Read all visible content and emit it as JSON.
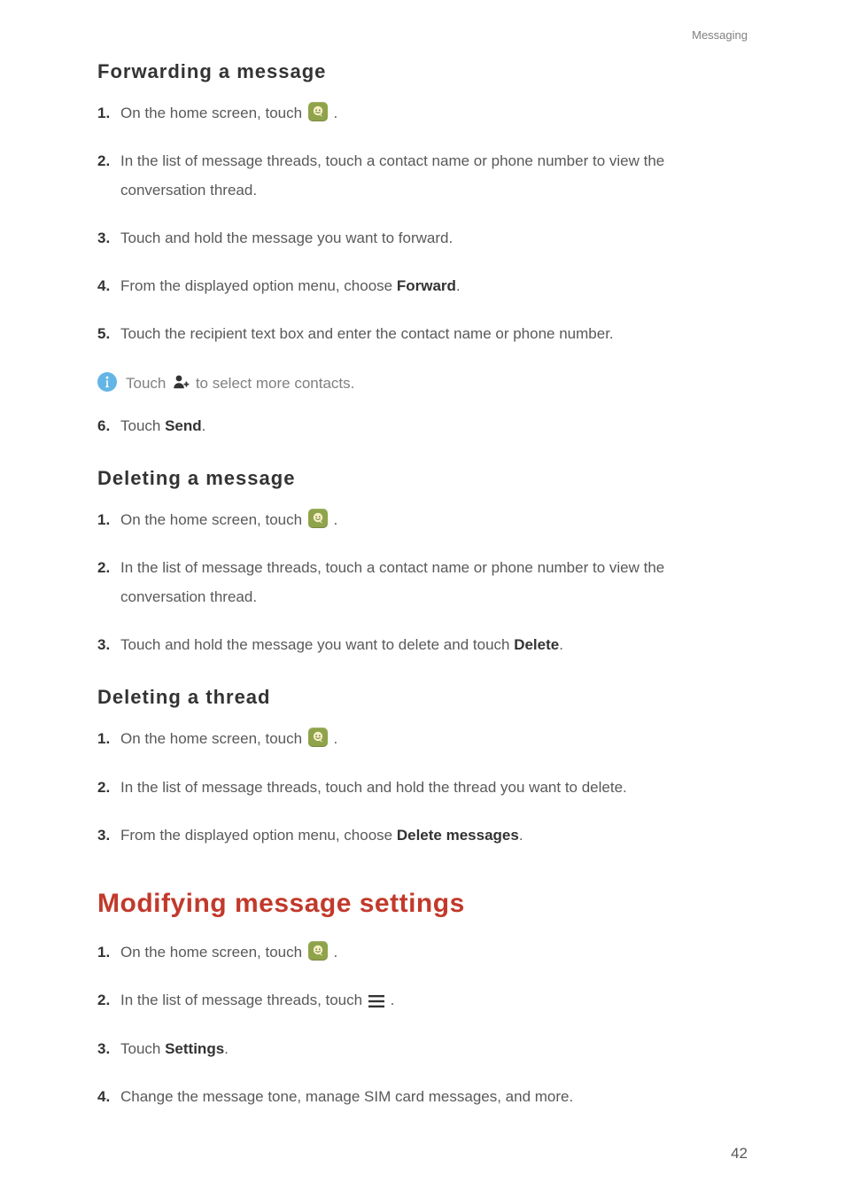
{
  "running_header": "Messaging",
  "page_number": "42",
  "sections": {
    "forwarding": {
      "heading": "Forwarding  a  message",
      "steps": {
        "s1_a": "On the home screen, touch ",
        "s1_b": ".",
        "s2": "In the list of message threads, touch a contact name or phone number to view the conversation thread.",
        "s3": "Touch and hold the message you want to forward.",
        "s4_a": "From the displayed option menu, choose ",
        "s4_b": "Forward",
        "s4_c": ".",
        "s5": "Touch the recipient text box and enter the contact name or phone number.",
        "note_a": "Touch ",
        "note_b": " to select more contacts.",
        "s6_a": "Touch ",
        "s6_b": "Send",
        "s6_c": "."
      }
    },
    "deleting_msg": {
      "heading": "Deleting  a  message",
      "steps": {
        "s1_a": "On the home screen, touch ",
        "s1_b": ".",
        "s2": "In the list of message threads, touch a contact name or phone number to view the conversation thread.",
        "s3_a": "Touch and hold the message you want to delete and touch ",
        "s3_b": "Delete",
        "s3_c": "."
      }
    },
    "deleting_thread": {
      "heading": "Deleting  a  thread",
      "steps": {
        "s1_a": "On the home screen, touch ",
        "s1_b": ".",
        "s2": "In the list of message threads, touch and hold the thread you want to delete.",
        "s3_a": "From the displayed option menu, choose ",
        "s3_b": "Delete messages",
        "s3_c": "."
      }
    },
    "modifying": {
      "heading": "Modifying message settings",
      "steps": {
        "s1_a": "On the home screen, touch ",
        "s1_b": ".",
        "s2_a": "In the list of message threads, touch ",
        "s2_b": ".",
        "s3_a": "Touch ",
        "s3_b": "Settings",
        "s3_c": ".",
        "s4": "Change the message tone, manage SIM card messages, and more."
      }
    }
  }
}
